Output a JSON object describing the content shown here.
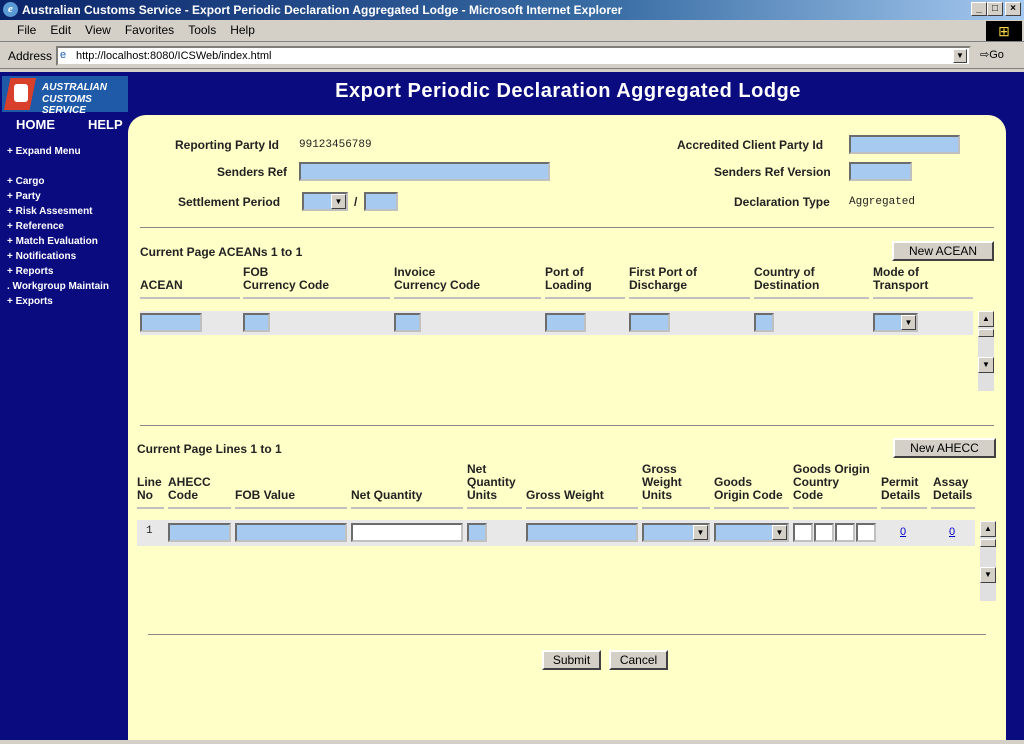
{
  "window": {
    "title": "Australian Customs Service - Export Periodic Declaration Aggregated Lodge - Microsoft Internet Explorer"
  },
  "menu": [
    "File",
    "Edit",
    "View",
    "Favorites",
    "Tools",
    "Help"
  ],
  "address": {
    "label": "Address",
    "url": "http://localhost:8080/ICSWeb/index.html",
    "go": "Go"
  },
  "logo": {
    "line1": "AUSTRALIAN",
    "line2": "CUSTOMS SERVICE"
  },
  "header": {
    "title": "Export Periodic Declaration Aggregated Lodge"
  },
  "nav": {
    "home": "HOME",
    "help": "HELP",
    "items": [
      "+ Expand Menu",
      "+ Cargo",
      "+ Party",
      "+ Risk Assesment",
      "+ Reference",
      "+ Match Evaluation",
      "+ Notifications",
      "+ Reports",
      ". Workgroup Maintain",
      "+ Exports"
    ]
  },
  "form": {
    "reporting_party_label": "Reporting Party Id",
    "reporting_party_value": "99123456789",
    "accredited_label": "Accredited Client Party Id",
    "senders_ref_label": "Senders Ref",
    "senders_ref_version_label": "Senders Ref Version",
    "settlement_label": "Settlement Period",
    "slash": "/",
    "decl_type_label": "Declaration Type",
    "decl_type_value": "Aggregated"
  },
  "acean": {
    "caption": "Current Page ACEANs 1 to 1",
    "new_button": "New ACEAN",
    "columns": [
      [
        "ACEAN"
      ],
      [
        "FOB",
        "Currency Code"
      ],
      [
        "Invoice",
        "Currency Code"
      ],
      [
        "Port of",
        "Loading"
      ],
      [
        "First Port of",
        "Discharge"
      ],
      [
        "Country of",
        "Destination"
      ],
      [
        "Mode of",
        "Transport"
      ]
    ]
  },
  "lines": {
    "caption": "Current Page Lines 1 to 1",
    "new_button": "New AHECC",
    "columns": [
      [
        "Line",
        "No"
      ],
      [
        "AHECC",
        "Code"
      ],
      [
        "FOB Value"
      ],
      [
        "Net Quantity"
      ],
      [
        "Net",
        "Quantity",
        "Units"
      ],
      [
        "Gross Weight"
      ],
      [
        "Gross",
        "Weight",
        "Units"
      ],
      [
        "Goods",
        "Origin Code"
      ],
      [
        "Goods Origin",
        "Country",
        "Code"
      ],
      [
        "Permit",
        "Details"
      ],
      [
        "Assay",
        "Details"
      ]
    ],
    "row": {
      "line_no": "1",
      "permit": "0",
      "assay": "0"
    }
  },
  "actions": {
    "submit": "Submit",
    "cancel": "Cancel"
  }
}
